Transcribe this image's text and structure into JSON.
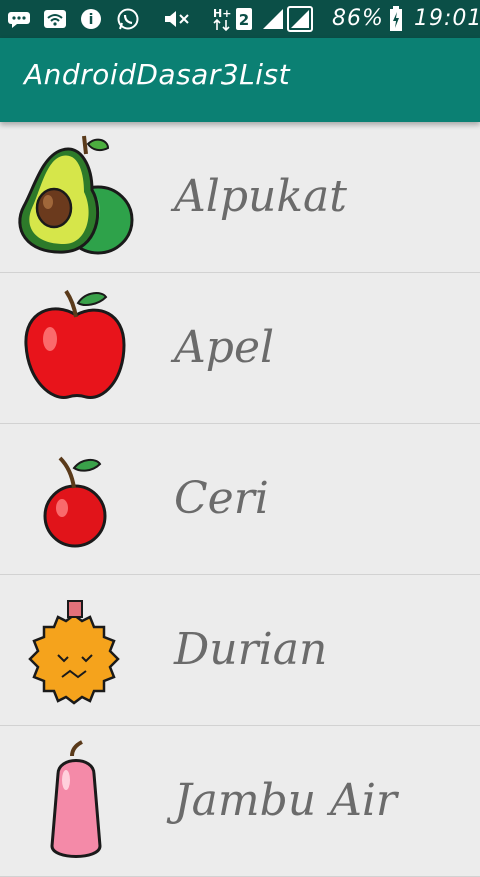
{
  "status_bar": {
    "battery": "86%",
    "time": "19:01",
    "network_type": "H+",
    "sim_slot": "2",
    "icons": [
      "messages-icon",
      "wifi-icon",
      "data-saver-icon",
      "whatsapp-icon",
      "mute-icon",
      "network-icon",
      "sim2-icon",
      "signal-icon",
      "signal-icon",
      "battery-charging-icon"
    ]
  },
  "app_bar": {
    "title": "AndroidDasar3List"
  },
  "list": {
    "items": [
      {
        "label": "Alpukat",
        "image": "avocado-icon"
      },
      {
        "label": "Apel",
        "image": "apple-icon"
      },
      {
        "label": "Ceri",
        "image": "cherry-icon"
      },
      {
        "label": "Durian",
        "image": "durian-icon"
      },
      {
        "label": "Jambu Air",
        "image": "rose-apple-icon"
      }
    ]
  },
  "colors": {
    "status_bar": "#0b4f47",
    "app_bar": "#0b8073",
    "list_background": "#ececec",
    "label_text": "#6b6b6b"
  }
}
